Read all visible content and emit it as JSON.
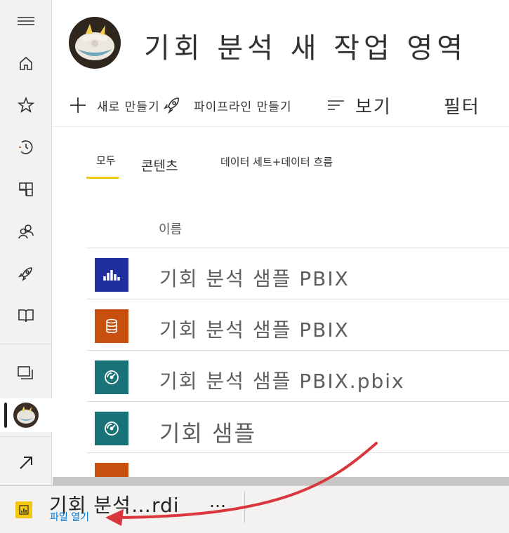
{
  "workspace": {
    "title": "기회 분석 새 작업 영역"
  },
  "toolbar": {
    "new_label": "새로 만들기",
    "pipeline_label": "파이프라인 만들기",
    "view_label": "보기",
    "filter_label": "필터"
  },
  "tabs": [
    {
      "label": "모두",
      "selected": true
    },
    {
      "label": "콘텐츠"
    },
    {
      "label": "데이터 세트+데이터 흐름"
    }
  ],
  "list": {
    "column_header": "이름",
    "rows": [
      {
        "name": "기회 분석 샘플 PBIX",
        "type": "report-icon",
        "color": "#1f2f9e"
      },
      {
        "name": "기회 분석 샘플 PBIX",
        "type": "dataset-icon",
        "color": "#c94f0f"
      },
      {
        "name": "기회 분석 샘플 PBIX.pbix",
        "type": "dashboard-icon",
        "color": "#197278"
      },
      {
        "name": "기회 샘플",
        "type": "dashboard-icon",
        "color": "#197278"
      },
      {
        "name": "",
        "type": "dataset-icon",
        "color": "#c94f0f"
      }
    ]
  },
  "download": {
    "file_name": "기회 분석…rdi",
    "open_label": "파일 열기",
    "more_label": "…"
  },
  "colors": {
    "accent": "#f2c811",
    "annotation_arrow": "#d9363e",
    "link": "#0078d4"
  }
}
